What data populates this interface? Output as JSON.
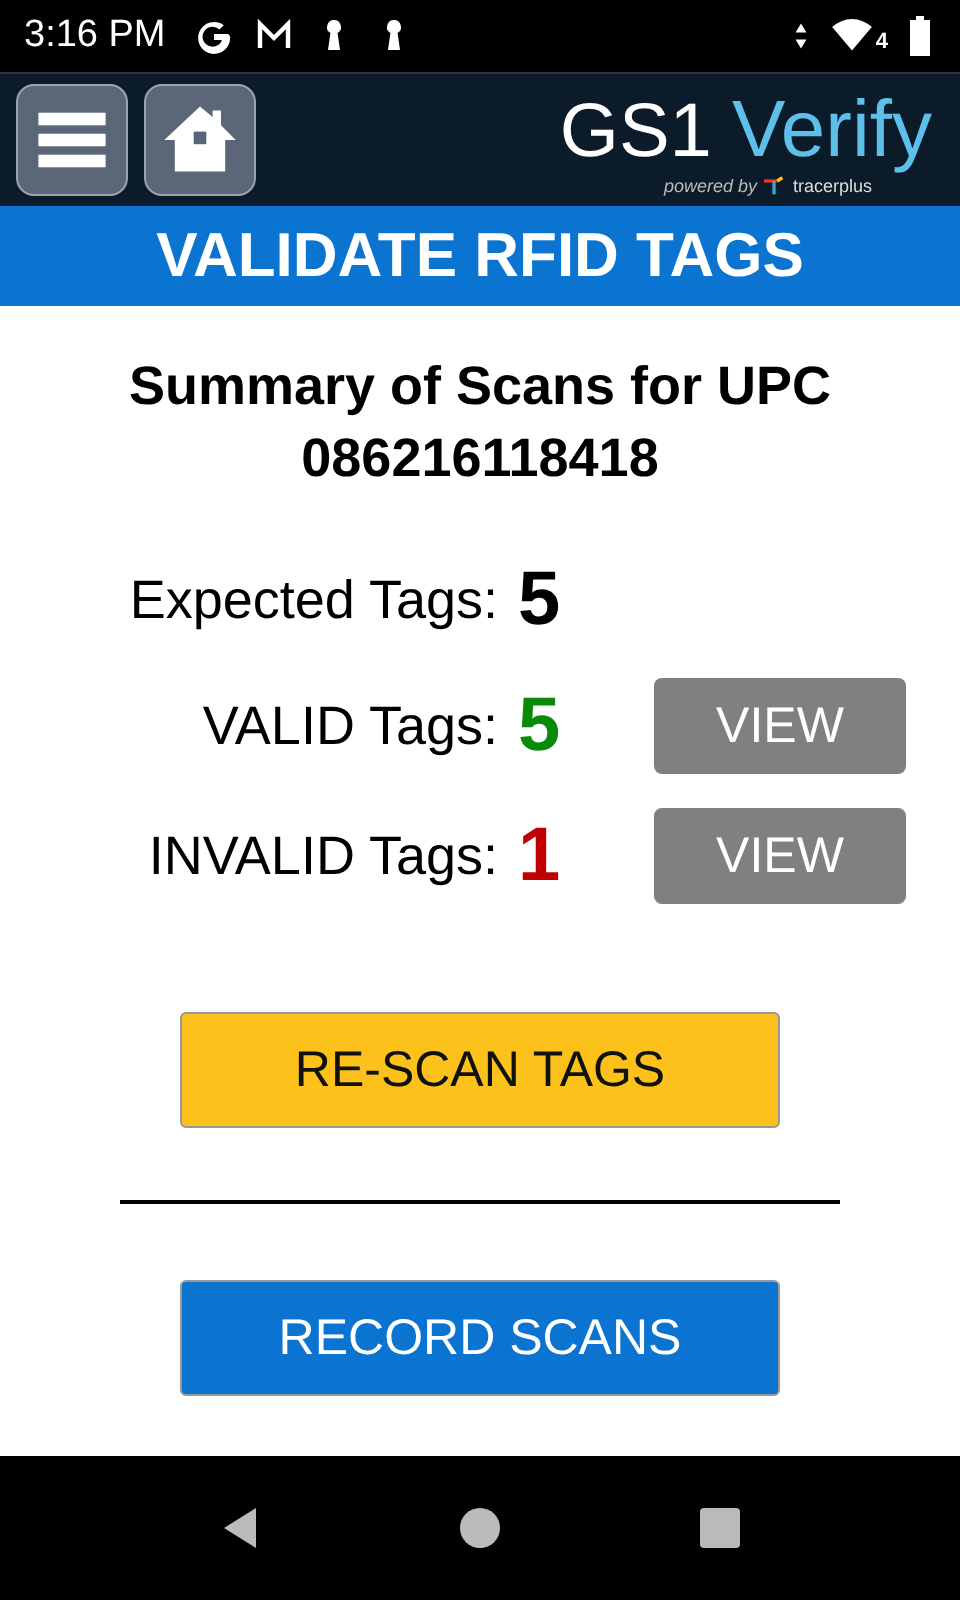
{
  "status_bar": {
    "time": "3:16 PM",
    "network_badge": "4"
  },
  "header": {
    "logo": {
      "brand": "GS1",
      "product": "Verify",
      "powered_by": "powered by",
      "partner": "tracerplus"
    }
  },
  "title": "VALIDATE RFID TAGS",
  "summary_heading": "Summary of Scans for UPC 086216118418",
  "counts": [
    {
      "label": "Expected Tags:",
      "value": "5",
      "color": "#000000"
    },
    {
      "label": "VALID Tags:",
      "value": "5",
      "color": "#0a8a0a",
      "action": "VIEW"
    },
    {
      "label": "INVALID Tags:",
      "value": "1",
      "color": "#c00000",
      "action": "VIEW"
    }
  ],
  "buttons": [
    {
      "label": "RE-SCAN TAGS",
      "kind": "secondary"
    },
    {
      "label": "RECORD SCANS",
      "kind": "primary"
    }
  ]
}
